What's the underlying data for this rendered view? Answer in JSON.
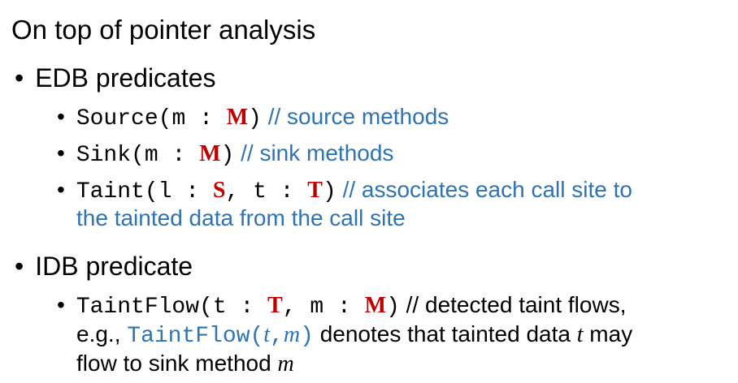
{
  "heading": "On top of pointer analysis",
  "sections": [
    {
      "title": "EDB predicates",
      "items": [
        {
          "name": "Source",
          "arg1": "m",
          "type1": "M",
          "comment": "// source methods"
        },
        {
          "name": "Sink",
          "arg1": "m",
          "type1": "M",
          "comment": "// sink methods"
        },
        {
          "name": "Taint",
          "arg1": "l",
          "type1": "S",
          "arg2": "t",
          "type2": "T",
          "comment_line1": "// associates each call site to",
          "comment_line2": "the tainted data from the call site"
        }
      ]
    },
    {
      "title": "IDB predicate",
      "items": [
        {
          "name": "TaintFlow",
          "arg1": "t",
          "type1": "T",
          "arg2": "m",
          "type2": "M",
          "comment": "// detected taint flows,",
          "eg_prefix": "e.g., ",
          "eg_code": "TaintFlow(",
          "eg_var1": "t",
          "eg_comma": ",",
          "eg_var2": "m",
          "eg_close": ")",
          "eg_text": " denotes that tainted data ",
          "eg_var3": "t",
          "eg_text2": " may",
          "line3_text": "flow to sink method ",
          "line3_var": "m"
        }
      ]
    }
  ],
  "glyphs": {
    "bullet": "•",
    "open_paren": "(",
    "colon": " : ",
    "comma_sep": ", ",
    "close_paren": ")"
  },
  "colors": {
    "type": "#c00000",
    "comment": "#2e74b5",
    "text": "#000000"
  }
}
